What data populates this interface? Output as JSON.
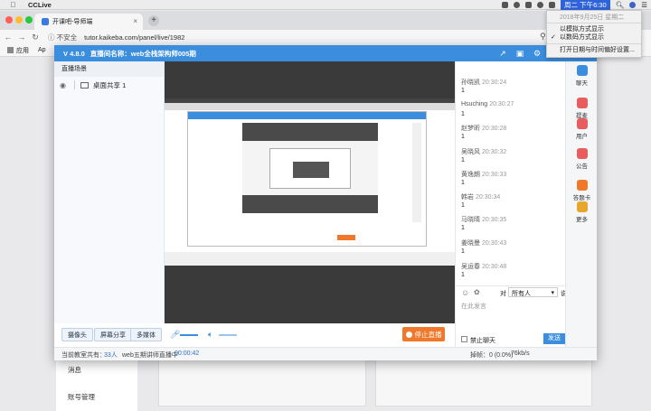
{
  "menubar": {
    "app_name": "CCLive",
    "clock": "周二 下午6:30"
  },
  "clock_menu": {
    "date": "2018年9月25日 星期二",
    "option_analog": "以模拟方式显示",
    "option_digital": "以数码方式显示",
    "option_prefs": "打开日期与时间偏好设置..."
  },
  "browser": {
    "tab_title": "开课吧-导师端",
    "security": "不安全",
    "url": "tutor.kaikeba.com/panel/live/1982",
    "bookmark_apps": "应用",
    "bookmark_2": "Ap"
  },
  "page": {
    "menu_messages": "消息",
    "menu_account": "账号管理"
  },
  "live": {
    "version": "V 4.8.0",
    "room_title": "直播间名称：web全栈架构师005期",
    "scene_panel_title": "直播场景",
    "scene_item": "桌面共享 1",
    "btn_camera": "摄像头",
    "btn_screen_share": "屏幕分享",
    "btn_multimedia": "多媒体",
    "btn_stop": "停止直播",
    "status_viewers_label": "当前教室共有：",
    "status_viewers_count": "33人",
    "status_course": "web五期讲师直播中",
    "status_time": "00:00:42",
    "status_loss": "掉帧：0 (0.0%)",
    "status_rate": "76kb/s"
  },
  "chat": {
    "messages": [
      {
        "name": "孙晓凯",
        "time": "20:30:24",
        "text": "1"
      },
      {
        "name": "Hsuching",
        "time": "20:30:27",
        "text": "1"
      },
      {
        "name": "赵梦昕",
        "time": "20:30:28",
        "text": "1"
      },
      {
        "name": "吴晓风",
        "time": "20:30:32",
        "text": "1"
      },
      {
        "name": "黄逸朗",
        "time": "20:30:33",
        "text": "1"
      },
      {
        "name": "韩岩",
        "time": "20:30:34",
        "text": "1"
      },
      {
        "name": "马晓晴",
        "time": "20:30:35",
        "text": "1"
      },
      {
        "name": "姜晓曼",
        "time": "20:30:43",
        "text": "1"
      },
      {
        "name": "吴运春",
        "time": "20:30:48",
        "text": "1"
      }
    ],
    "to_label": "对",
    "to_value": "所有人",
    "say_label": "说:",
    "input_placeholder": "在此发言",
    "ban_label": "禁止聊天",
    "send_label": "发送"
  },
  "right_bar": {
    "items": [
      {
        "label": "聊天",
        "color": "#3b8dde"
      },
      {
        "label": "提麦",
        "color": "#e85d5d"
      },
      {
        "label": "用户",
        "color": "#e85d5d"
      },
      {
        "label": "公告",
        "color": "#e85d5d"
      },
      {
        "label": "答题卡",
        "color": "#f0782a"
      },
      {
        "label": "更多",
        "color": "#e8a72a"
      }
    ]
  }
}
